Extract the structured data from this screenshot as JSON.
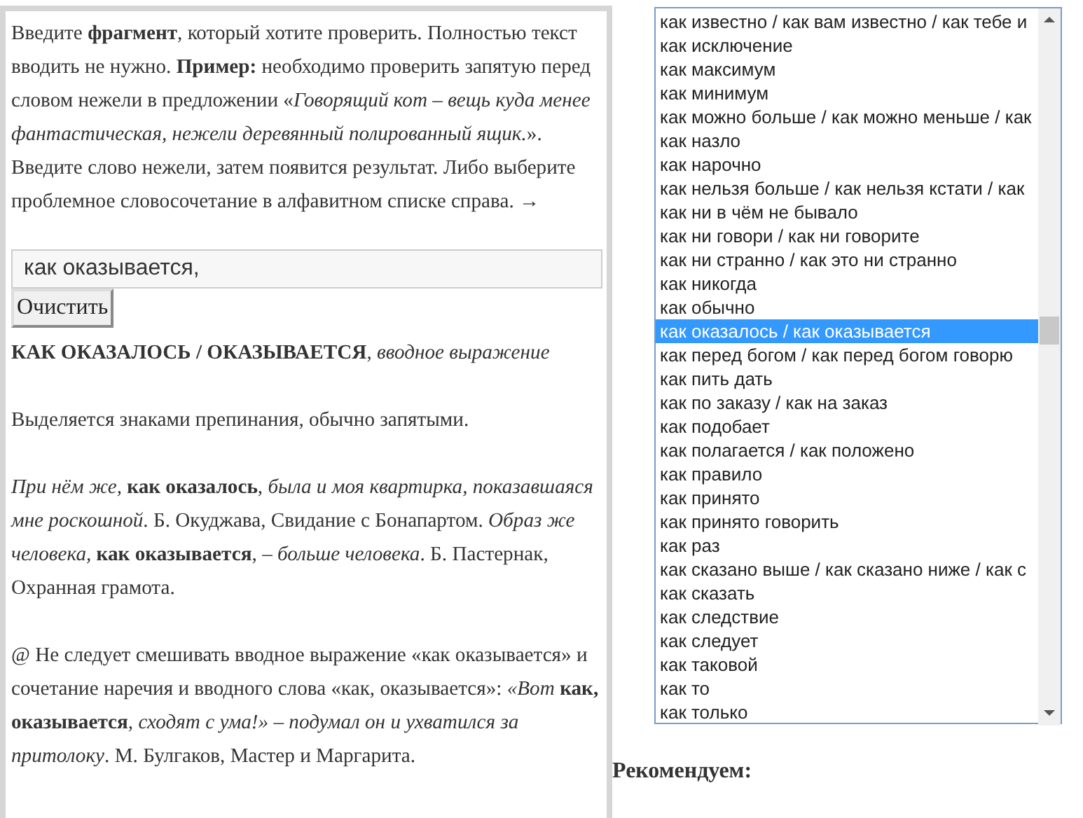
{
  "intro": "Введите **фрагмент**, который хотите проверить. Полностью текст вводить не нужно. **Пример:** необходимо проверить запятую перед словом нежели в предложении «*Говорящий кот – вещь куда менее фантастическая, нежели деревянный полированный ящик.*». Введите слово нежели, затем появится результат. Либо выберите проблемное словосочетание в алфавитном списке справа. →",
  "search": {
    "value": "как оказывается,"
  },
  "clear_button": "Очистить",
  "result": {
    "heading": "**КАК ОКАЗАЛОСЬ / ОКАЗЫВАЕТСЯ**, *вводное выражение*",
    "paragraphs": [
      "Выделяется знаками препинания, обычно запятыми.",
      "*При нём же,* **как оказалось**, *была и моя квартирка, показавшаяся мне роскошной*. Б. Окуджава, Свидание с Бонапартом. *Образ же человека,* **как оказывается**, *– больше человека*. Б. Пастернак, Охранная грамота.",
      "@ Не следует смешивать вводное выражение «как оказывается» и сочетание наречия и вводного слова «как, оказывается»: *«Вот* **как, оказывается**, *сходят с ума!» – подумал он и ухватился за притолоку*. М. Булгаков, Мастер и Маргарита."
    ]
  },
  "phrase_list": [
    {
      "label": "как известно / как вам известно / как тебе и",
      "selected": false
    },
    {
      "label": "как исключение",
      "selected": false
    },
    {
      "label": "как максимум",
      "selected": false
    },
    {
      "label": "как минимум",
      "selected": false
    },
    {
      "label": "как можно больше / как можно меньше / как",
      "selected": false
    },
    {
      "label": "как назло",
      "selected": false
    },
    {
      "label": "как нарочно",
      "selected": false
    },
    {
      "label": "как нельзя больше / как нельзя кстати / как",
      "selected": false
    },
    {
      "label": "как ни в чём не бывало",
      "selected": false
    },
    {
      "label": "как ни говори / как ни говорите",
      "selected": false
    },
    {
      "label": "как ни странно / как это ни странно",
      "selected": false
    },
    {
      "label": "как никогда",
      "selected": false
    },
    {
      "label": "как обычно",
      "selected": false
    },
    {
      "label": "как оказалось / как оказывается",
      "selected": true
    },
    {
      "label": "как перед богом / как перед богом говорю",
      "selected": false
    },
    {
      "label": "как пить дать",
      "selected": false
    },
    {
      "label": "как по заказу / как на заказ",
      "selected": false
    },
    {
      "label": "как подобает",
      "selected": false
    },
    {
      "label": "как полагается / как положено",
      "selected": false
    },
    {
      "label": "как правило",
      "selected": false
    },
    {
      "label": "как принято",
      "selected": false
    },
    {
      "label": "как принято говорить",
      "selected": false
    },
    {
      "label": "как раз",
      "selected": false
    },
    {
      "label": "как сказано выше / как сказано ниже / как с",
      "selected": false
    },
    {
      "label": "как сказать",
      "selected": false
    },
    {
      "label": "как следствие",
      "selected": false
    },
    {
      "label": "как следует",
      "selected": false
    },
    {
      "label": "как таковой",
      "selected": false
    },
    {
      "label": "как то",
      "selected": false
    },
    {
      "label": "как только",
      "selected": false
    }
  ],
  "recommend_heading": "Рекомендуем:"
}
